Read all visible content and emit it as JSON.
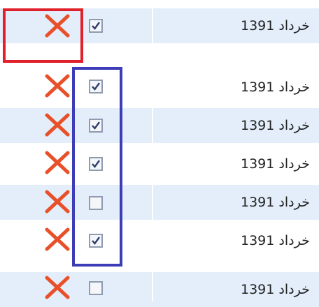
{
  "colors": {
    "row_alt": "#e3eefa",
    "delete_icon": "#e8502a",
    "highlight_red": "#e0202a",
    "highlight_blue": "#3d3db8"
  },
  "icons": {
    "delete": "close-icon",
    "checkbox": "checkbox"
  },
  "rows": [
    {
      "text": "خرداد 1391",
      "checked": true
    },
    {
      "text": "خرداد 1391",
      "checked": true
    },
    {
      "text": "خرداد 1391",
      "checked": true
    },
    {
      "text": "خرداد 1391",
      "checked": true
    },
    {
      "text": "خرداد 1391",
      "checked": false
    },
    {
      "text": "خرداد 1391",
      "checked": true
    },
    {
      "text": "خرداد 1391",
      "checked": false
    }
  ]
}
